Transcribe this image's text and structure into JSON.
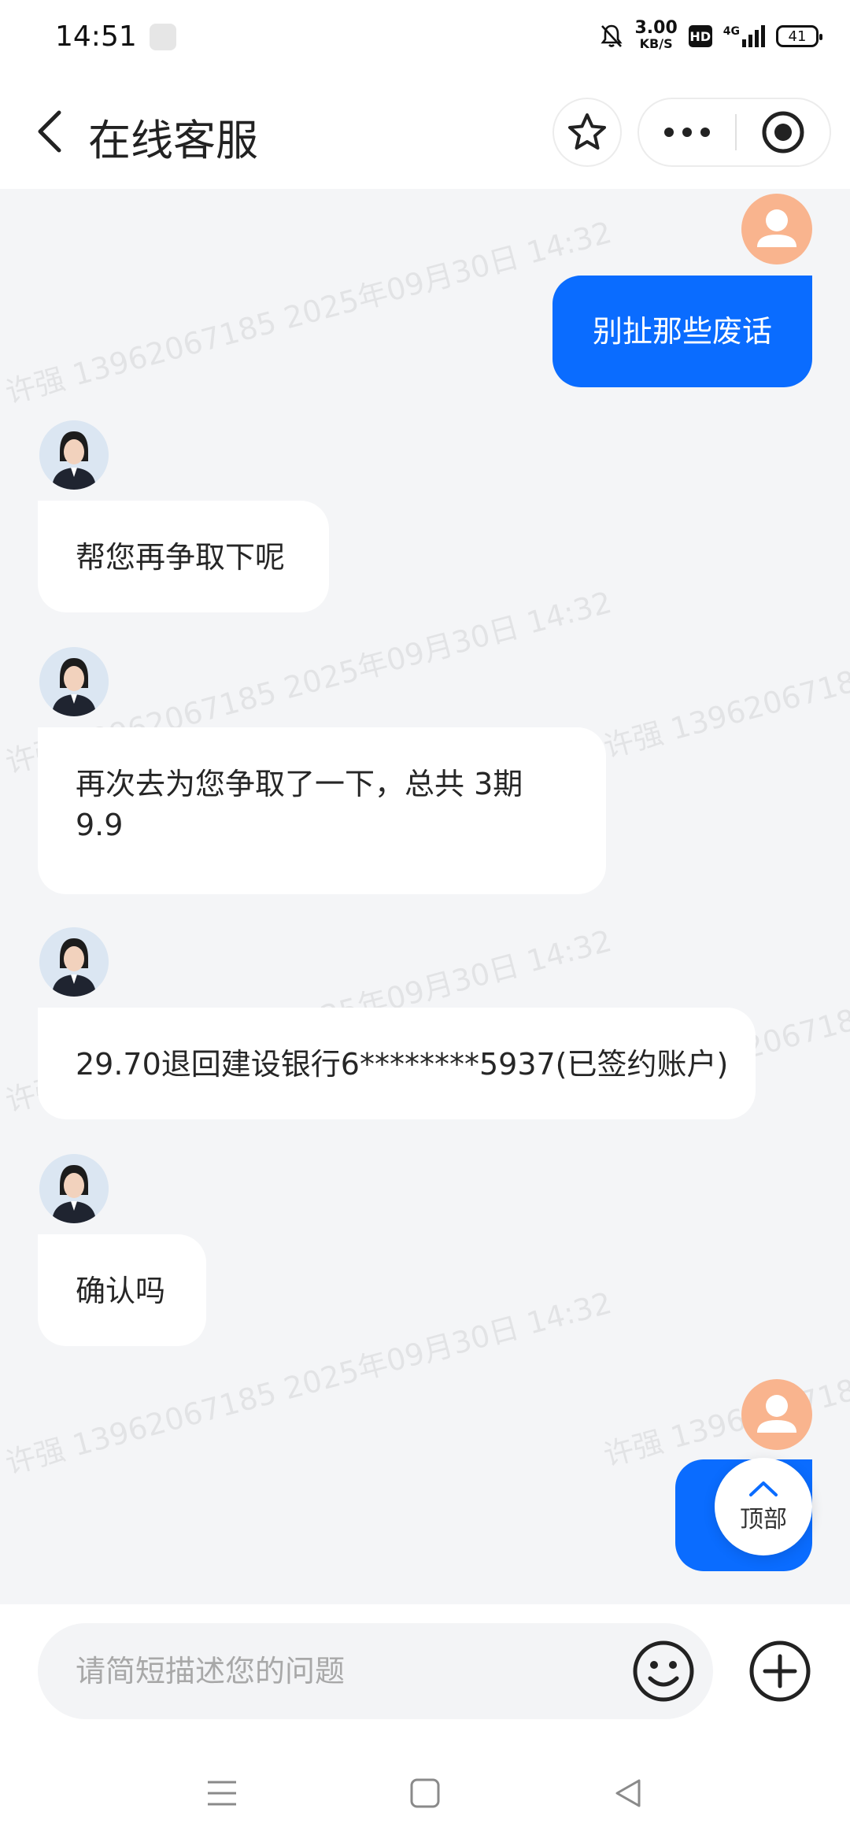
{
  "status_bar": {
    "time": "14:51",
    "net_speed_value": "3.00",
    "net_speed_unit": "KB/S",
    "hd_label": "HD",
    "signal_label": "4G",
    "battery_level": "41"
  },
  "header": {
    "title": "在线客服",
    "icons": [
      "back-arrow-icon",
      "star-icon",
      "more-icon",
      "close-target-icon"
    ]
  },
  "watermark": "许强 13962067185 2025年09月30日 14:32",
  "messages": [
    {
      "sender": "user",
      "text": "别扯那些废话"
    },
    {
      "sender": "agent",
      "text": "帮您再争取下呢"
    },
    {
      "sender": "agent",
      "text": "再次去为您争取了一下，总共 3期9.9"
    },
    {
      "sender": "agent",
      "text": "29.70退回建设银行6********5937(已签约账户)"
    },
    {
      "sender": "agent",
      "text": "确认吗"
    },
    {
      "sender": "user",
      "text": ""
    }
  ],
  "scroll_top": {
    "label": "顶部"
  },
  "input": {
    "placeholder": "请简短描述您的问题",
    "value": ""
  },
  "colors": {
    "accent": "#0a6cff",
    "background": "#f4f5f7",
    "user_avatar": "#f9b48e"
  }
}
